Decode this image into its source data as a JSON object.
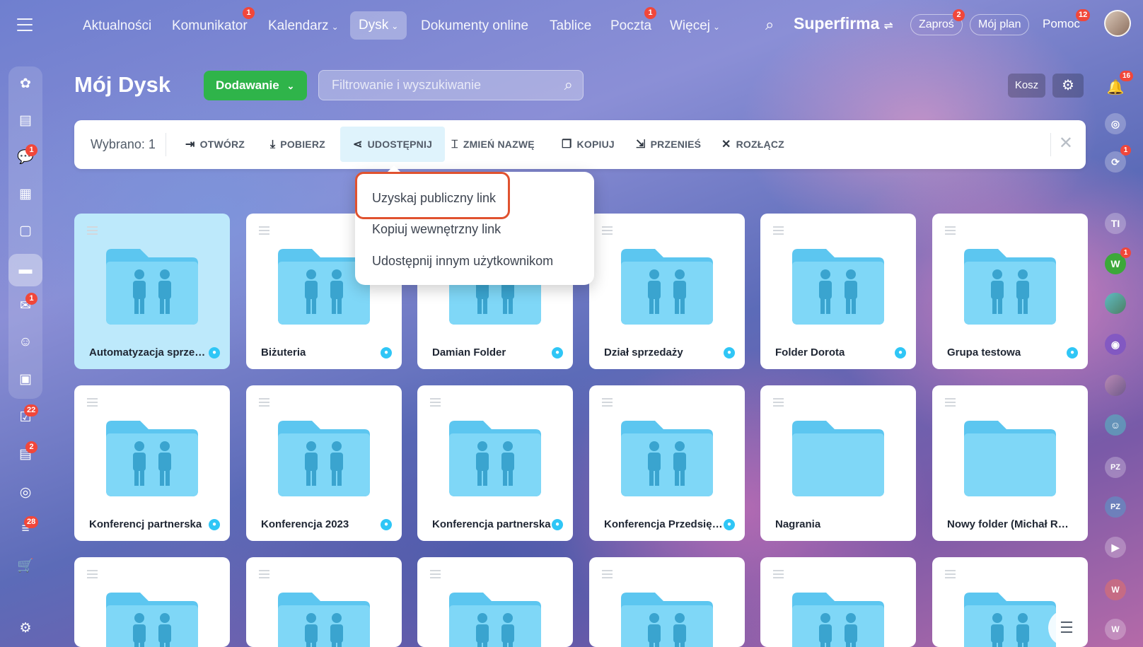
{
  "colors": {
    "accent_green": "#2fb44a",
    "badge_red": "#f1473a",
    "folder_blue": "#7fd7f7",
    "highlight_orange": "#e0522f"
  },
  "nav": {
    "items": [
      {
        "label": "Aktualności"
      },
      {
        "label": "Komunikator",
        "badge": "1"
      },
      {
        "label": "Kalendarz",
        "chevron": true
      },
      {
        "label": "Dysk",
        "chevron": true,
        "active": true
      },
      {
        "label": "Dokumenty online"
      },
      {
        "label": "Tablice"
      },
      {
        "label": "Poczta",
        "badge": "1"
      },
      {
        "label": "Więcej",
        "chevron": true
      }
    ],
    "brand": "Superfirma",
    "invite": {
      "label": "Zaproś",
      "badge": "2"
    },
    "plan": {
      "label": "Mój plan"
    },
    "help": {
      "label": "Pomoc",
      "badge": "12"
    }
  },
  "left_rail": {
    "badges": {
      "chat": "1",
      "mail": "1",
      "tasks": "22",
      "crm": "2",
      "feed": "28"
    }
  },
  "header": {
    "title": "Mój Dysk",
    "add_label": "Dodawanie",
    "search_placeholder": "Filtrowanie i wyszukiwanie",
    "trash_label": "Kosz"
  },
  "toolbar": {
    "selected": "Wybrano: 1",
    "open": "OTWÓRZ",
    "download": "POBIERZ",
    "share": "UDOSTĘPNIJ",
    "rename": "ZMIEŃ NAZWĘ",
    "copy": "KOPIUJ",
    "move": "PRZENIEŚ",
    "detach": "ROZŁĄCZ"
  },
  "dropdown": {
    "items": [
      "Uzyskaj publiczny link",
      "Kopiuj wewnętrzny link",
      "Udostępnij innym użytkownikom"
    ]
  },
  "folders": [
    {
      "name": "Automatyzacja sprzedaży",
      "shared": true,
      "selected": true
    },
    {
      "name": "Biżuteria",
      "shared": true
    },
    {
      "name": "Damian Folder",
      "shared": true
    },
    {
      "name": "Dział sprzedaży",
      "shared": true
    },
    {
      "name": "Folder Dorota",
      "shared": true
    },
    {
      "name": "Grupa testowa",
      "shared": true
    },
    {
      "name": "Konferencj partnerska",
      "shared": true
    },
    {
      "name": "Konferencja 2023",
      "shared": true
    },
    {
      "name": "Konferencja partnerska",
      "shared": true
    },
    {
      "name": "Konferencja Przedsiębiorców",
      "shared": true
    },
    {
      "name": "Nagrania",
      "shared": false
    },
    {
      "name": "Nowy folder (Michał Radomski)",
      "shared": false
    }
  ],
  "right_rail": {
    "notifications_badge": "16",
    "chat_badge": "1",
    "user_badge": "1",
    "avatars": [
      "TI",
      "W",
      "PZ",
      "PZ",
      "W",
      "W"
    ]
  }
}
